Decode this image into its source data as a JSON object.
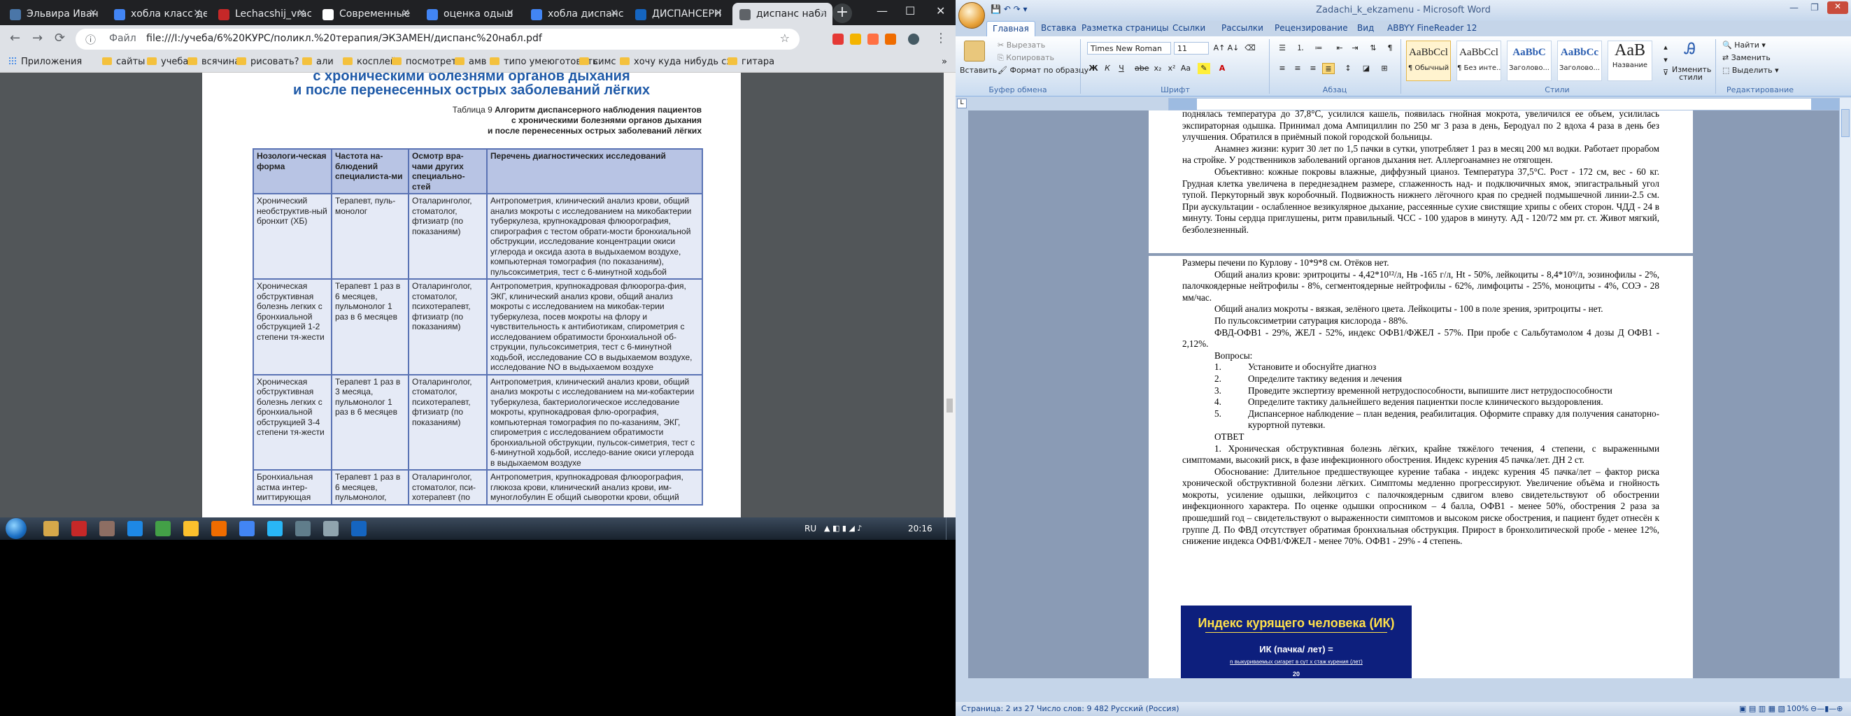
{
  "chrome": {
    "tabs": [
      {
        "label": "Эльвира Иван",
        "color": "#4a76a8"
      },
      {
        "label": "хобла класс ден",
        "color": "#4285f4"
      },
      {
        "label": "Lechacshij_vrac",
        "color": "#c62828"
      },
      {
        "label": "Современные",
        "color": "#ffffff"
      },
      {
        "label": "оценка одыш",
        "color": "#4285f4"
      },
      {
        "label": "хобла диспанс",
        "color": "#4285f4"
      },
      {
        "label": "ДИСПАНСЕРН",
        "color": "#1565c0"
      },
      {
        "label": "диспанс набл",
        "color": "#5f6368"
      }
    ],
    "new_tab": "+",
    "window_controls": {
      "minimize": "—",
      "maximize": "☐",
      "close": "✕"
    },
    "nav": {
      "back": "←",
      "forward": "→",
      "reload": "⟳"
    },
    "address": {
      "info": "ⓘ",
      "scheme": "Файл",
      "url": "file:///I:/учеба/6%20КУРС/поликл.%20терапия/ЭКЗАМЕН/диспанс%20набл.pdf",
      "star": "☆"
    },
    "extensions": [
      "#e53935",
      "#f4b400",
      "#ff7043",
      "#ef6c00",
      "#455a64"
    ],
    "menu": "⋮",
    "bookmarks": {
      "apps": "Приложения",
      "items": [
        "сайты",
        "учеба",
        "всячина",
        "рисовать?",
        "али",
        "косплей",
        "посмотреть",
        "амв",
        "типо умеюготовить",
        "симс",
        "хочу куда нибудь сх",
        "гитара"
      ],
      "more": "»"
    }
  },
  "pdf": {
    "heading": [
      "с хроническими болезнями органов дыхания",
      "и после перенесенных острых заболеваний лёгких"
    ],
    "caption_prefix": "Таблица 9",
    "caption_lines": [
      "Алгоритм диспансерного наблюдения пациентов",
      "с хроническими болезнями органов дыхания",
      "и после перенесенных острых заболеваний лёгких"
    ],
    "columns": [
      "Нозологи-ческая форма",
      "Частота на-блюдений специалиста-ми",
      "Осмотр вра-чами других специально-стей",
      "Перечень диагностических исследований"
    ],
    "rows": [
      [
        "Хронический необструктив-ный бронхит (ХБ)",
        "Терапевт, пуль-монолог",
        "Оталаринголог, стоматолог, фтизиатр (по показаниям)",
        "Антропометрия, клинический анализ крови, общий анализ мокроты с исследованием на микобактерии туберкулеза, крупнокадровая флюорография, спирография с тестом обрати-мости бронхиальной обструкции, исследование концентрации окиси углерода и оксида азота в выдыхаемом воздухе, компьютерная томография (по показаниям), пульсоксиметрия, тест с 6-минутной ходьбой"
      ],
      [
        "Хроническая обструктивная болезнь легких с бронхиальной обструкцией 1-2 степени тя-жести",
        "Терапевт 1 раз в 6 месяцев, пульмонолог 1 раз в 6 месяцев",
        "Оталаринголог, стоматолог, психотерапевт, фтизиатр (по показаниям)",
        "Антропометрия, крупнокадровая флюорогра-фия, ЭКГ, клинический анализ крови, общий анализ мокроты с исследованием на микобак-терии туберкулеза, посев мокроты на флору и чувствительность к антибиотикам, спирометрия с исследованием обратимости бронхиальной об-струкции, пульсоксиметрия, тест с 6-минутной ходьбой, исследование СО в выдыхаемом воздухе, исследование NO в выдыхаемом воздухе"
      ],
      [
        "Хроническая обструктивная болезнь легких с бронхиальной обструкцией 3-4 степени тя-жести",
        "Терапевт 1 раз в 3 месяца, пульмонолог 1 раз в 6 месяцев",
        "Оталаринголог, стоматолог, психотерапевт, фтизиатр (по показаниям)",
        "Антропометрия, клинический анализ крови, общий анализ мокроты с исследованием на ми-кобактерии туберкулеза, бактериологическое исследование мокроты, крупнокадровая флю-орография, компьютерная томография по по-казаниям, ЭКГ, спирометрия с исследованием обратимости бронхиальной обструкции, пульсок-симетрия, тест с 6-минутной ходьбой, исследо-вание окиси углерода в выдыхаемом воздухе"
      ],
      [
        "Бронхиальная астма интер-миттирующая",
        "Терапевт 1 раз в 6 месяцев, пульмонолог,",
        "Оталаринголог, стоматолог, пси-хотерапевт (по",
        "Антропометрия, крупнокадровая флюорография, глюкоза крови, клинический анализ крови, им-муноглобулин Е общий сыворотки крови, общий"
      ]
    ]
  },
  "taskbar": {
    "lang": "RU",
    "time": "20:16",
    "apps": [
      "#d6a84a",
      "#c62828",
      "#8d6e63",
      "#1e88e5",
      "#43a047",
      "#fbc02d",
      "#ef6c00",
      "#4285f4",
      "#29b6f6",
      "#607d8b",
      "#90a4ae",
      "#1565c0"
    ]
  },
  "word": {
    "title": "Zadachi_k_ekzamenu - Microsoft Word",
    "tabs": [
      "Главная",
      "Вставка",
      "Разметка страницы",
      "Ссылки",
      "Рассылки",
      "Рецензирование",
      "Вид",
      "ABBYY FineReader 12"
    ],
    "clipboard": {
      "paste": "Вставить",
      "cut": "Вырезать",
      "copy": "Копировать",
      "format_painter": "Формат по образцу",
      "label": "Буфер обмена"
    },
    "font": {
      "name": "Times New Roman",
      "size": "11",
      "label": "Шрифт"
    },
    "paragraph_label": "Абзац",
    "styles": {
      "items": [
        {
          "sample": "AaBbCcl",
          "label": "¶ Обычный"
        },
        {
          "sample": "AaBbCcl",
          "label": "¶ Без инте..."
        },
        {
          "sample": "AaBbC",
          "label": "Заголово..."
        },
        {
          "sample": "AaBbCc",
          "label": "Заголово..."
        },
        {
          "sample": "AaB",
          "label": "Название"
        }
      ],
      "change": "Изменить стили",
      "label": "Стили"
    },
    "editing": {
      "find": "Найти",
      "replace": "Заменить",
      "select": "Выделить",
      "label": "Редактирование"
    },
    "page1_paragraphs": [
      {
        "text": "поднялась температура до 37,8°С, усилился кашель, появилась гнойная мокрота, увеличился ее объем, усилилась экспираторная одышка. Принимал дома Ампициллин по 250 мг 3 раза в день, Беродуал по 2 вдоха 4 раза в день без улучшения. Обратился в приёмный покой городской больницы.",
        "indent": false
      },
      {
        "text": "Анамнез жизни: курит 30 лет по 1,5 пачки в сутки, употребляет 1 раз в месяц 200 мл водки. Работает прорабом на стройке. У родственников заболеваний органов дыхания нет. Аллергоанамнез не отягощен.",
        "indent": true
      },
      {
        "text": "Объективно: кожные покровы влажные, диффузный цианоз. Температура 37,5°С. Рост - 172 см, вес - 60 кг. Грудная клетка увеличена в переднезаднем размере, сглаженность над- и подключичных ямок, эпигастральный угол тупой. Перкуторный звук коробочный. Подвижность нижнего лёгочного края по средней подмышечной линии-2.5 см. При аускультации - ослабленное везикулярное дыхание, рассеянные сухие свистящие хрипы с обеих сторон. ЧДД - 24 в минуту. Тоны сердца приглушены, ритм правильный. ЧСС - 100 ударов в минуту. АД - 120/72 мм рт. ст. Живот мягкий, безболезненный.",
        "indent": true
      }
    ],
    "page2_paragraphs": [
      {
        "text": "Размеры печени по Курлову - 10*9*8 см. Отёков нет.",
        "indent": false
      },
      {
        "text": "Общий анализ крови: эритроциты - 4,42*10¹²/л, Нв -165 г/л, Нt - 50%, лейкоциты - 8,4*10⁹/л, эозинофилы - 2%, палочкоядерные нейтрофилы - 8%, сегментоядерные нейтрофилы - 62%, лимфоциты - 25%, моноциты - 4%, СОЭ - 28 мм/час.",
        "indent": true
      },
      {
        "text": "Общий анализ мокроты - вязкая, зелёного цвета. Лейкоциты - 100 в поле зрения, эритроциты - нет.",
        "indent": true
      },
      {
        "text": "По пульсоксиметрии сатурация кислорода - 88%.",
        "indent": true
      },
      {
        "text": "ФВД-ОФВ1 - 29%, ЖЕЛ - 52%, индекс ОФВ1/ФЖЕЛ - 57%. При пробе с Сальбутамолом 4 дозы Д ОФВ1 - 2,12%.",
        "indent": true
      },
      {
        "text": "Вопросы:",
        "indent": true
      }
    ],
    "questions": [
      {
        "n": "1.",
        "text": "Установите и обоснуйте диагноз"
      },
      {
        "n": "2.",
        "text": "Определите тактику ведения и лечения"
      },
      {
        "n": "3.",
        "text": "Проведите экспертизу временной нетрудоспособности, выпишите лист нетрудоспособности"
      },
      {
        "n": "4.",
        "text": "Определите тактику дальнейшего ведения пациентки после клинического выздоровления."
      },
      {
        "n": "5.",
        "text": "Диспансерное наблюдение – план ведения, реабилитация. Оформите справку для получения санаторно-курортной путевки."
      }
    ],
    "answer_heading": "ОТВЕТ",
    "answer_paragraphs": [
      {
        "text": "1. Хроническая обструктивная болезнь лёгких, крайне тяжёлого течения, 4 степени, с выраженными симптомами, высокий риск, в фазе инфекционного обострения. Индекс курения 45 пачка/лет. ДН 2 ст.",
        "indent": true
      },
      {
        "text": "Обоснование: Длительное предшествующее курение табака - индекс курения 45 пачка/лет – фактор риска хронической обструктивной болезни лёгких. Симптомы медленно прогрессируют. Увеличение объёма и гнойность мокроты, усиление одышки, лейкоцитоз с палочкоядерным сдвигом влево свидетельствуют об обострении инфекционного характера. По оценке одышки опросником – 4 балла, ОФВ1 - менее 50%, обострения 2 раза за прошедший год – свидетельствуют о выраженности симптомов и высоком риске обострения, и пациент будет отнесён к группе Д. По ФВД отсутствует обратимая бронхиальная обструкция. Прирост в бронхолитической пробе - менее 12%, снижение индекса ОФВ1/ФЖЕЛ - менее 70%. ОФВ1 - 29% - 4 степень.",
        "indent": true
      }
    ],
    "figure": {
      "title": "Индекс курящего человека (ИК)",
      "formula": "ИК (пачка/ лет) =",
      "numerator": "n выкуриваемых сигарет в сут  х стаж курения (лет)",
      "denominator": "20"
    },
    "status": {
      "page": "Страница: 2 из 27",
      "words": "Число слов: 9 482",
      "lang": "Русский (Россия)",
      "zoom": "100%"
    }
  }
}
